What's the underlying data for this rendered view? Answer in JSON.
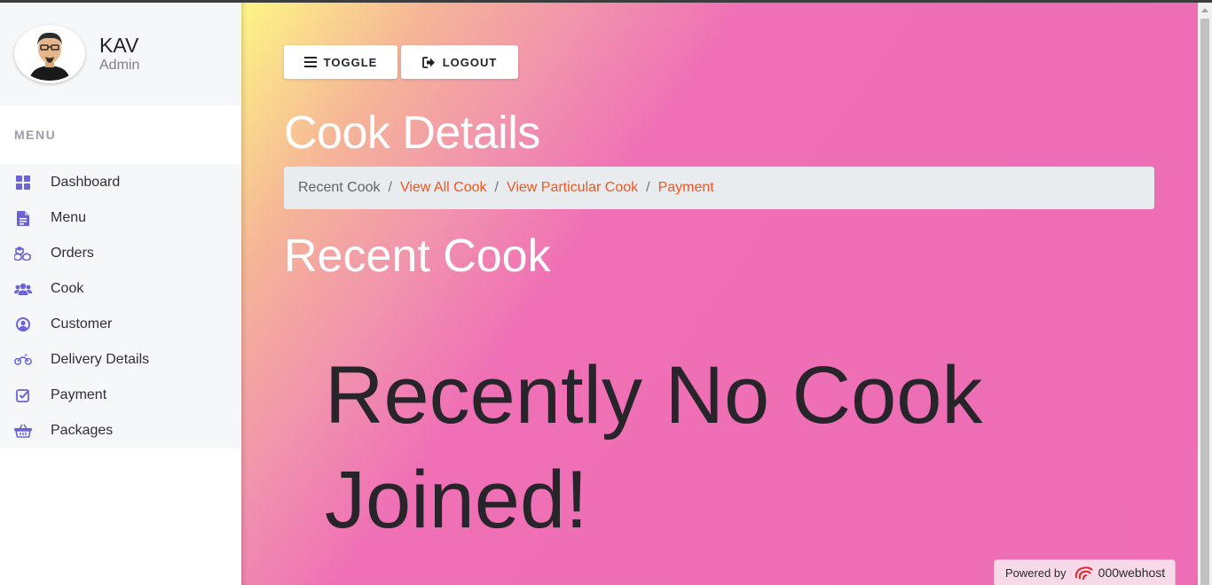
{
  "profile": {
    "name": "KAV",
    "role": "Admin"
  },
  "sidebar": {
    "heading": "MENU",
    "items": [
      {
        "label": "Dashboard",
        "icon": "dashboard-icon"
      },
      {
        "label": "Menu",
        "icon": "document-icon"
      },
      {
        "label": "Orders",
        "icon": "cubes-icon"
      },
      {
        "label": "Cook",
        "icon": "users-icon"
      },
      {
        "label": "Customer",
        "icon": "user-circle-icon"
      },
      {
        "label": "Delivery Details",
        "icon": "motorcycle-icon"
      },
      {
        "label": "Payment",
        "icon": "check-square-icon"
      },
      {
        "label": "Packages",
        "icon": "basket-icon"
      }
    ]
  },
  "toolbar": {
    "toggle_label": "TOGGLE",
    "logout_label": "LOGOUT"
  },
  "page": {
    "title": "Cook Details",
    "section_title": "Recent Cook",
    "empty_message": "Recently No Cook Joined!"
  },
  "breadcrumb": {
    "current": "Recent Cook",
    "links": [
      "View All Cook",
      "View Particular Cook",
      "Payment"
    ]
  },
  "footer": {
    "powered_label": "Powered by",
    "brand": "000webhost"
  },
  "colors": {
    "accent_icon": "#6c63d8",
    "link": "#f2551d",
    "gradient_start": "#fef686",
    "gradient_end": "#ee6db5"
  }
}
